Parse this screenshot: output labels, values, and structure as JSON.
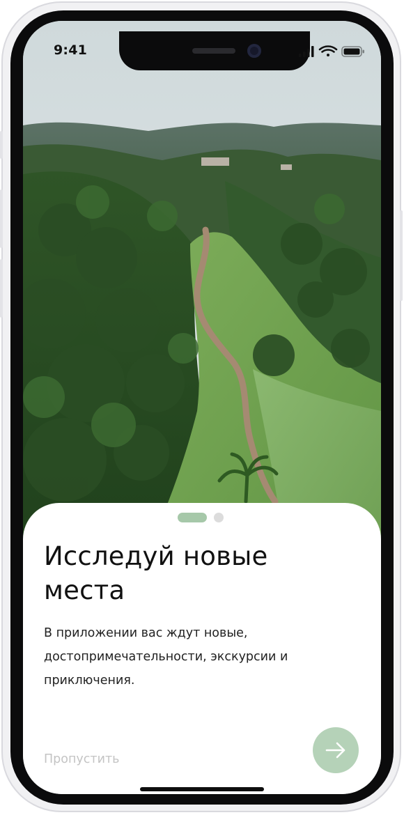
{
  "status_bar": {
    "time": "9:41",
    "icons": [
      "signal-icon",
      "wifi-icon",
      "battery-icon"
    ]
  },
  "hero": {
    "description": "forested ridge with a winding dirt path"
  },
  "onboarding": {
    "title": "Исследуй новые места",
    "description": "В приложении вас ждут новые, достопримечательности, экскурсии и приключения.",
    "skip_label": "Пропустить",
    "next_icon": "arrow-right-icon",
    "pages_total": 2,
    "current_page": 1
  },
  "colors": {
    "accent": "#a6c8a9",
    "next_button": "#b5d2b8",
    "inactive_dot": "#dcdcdc",
    "skip_text": "#c4c4c4"
  }
}
